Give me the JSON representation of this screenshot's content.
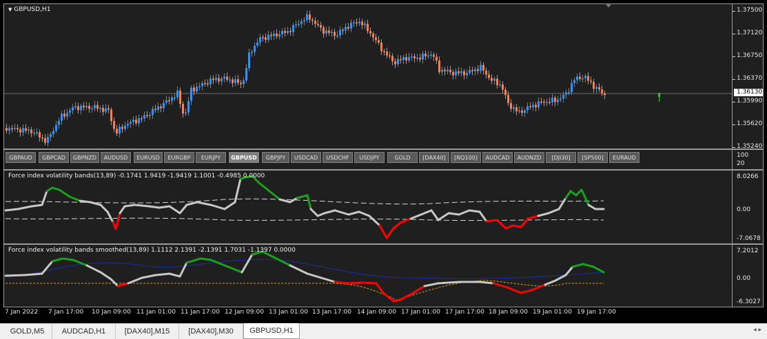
{
  "chart": {
    "symbol_title": "GBPUSD,H1"
  },
  "price_axis": {
    "labels": [
      "1.37500",
      "1.37120",
      "1.36750",
      "1.36370",
      "1.35990",
      "1.35620",
      "1.35240"
    ],
    "current_price": "1.36130"
  },
  "symbol_buttons": [
    {
      "label": "GBPAUD"
    },
    {
      "label": "GBPCAD"
    },
    {
      "label": "GBPNZD"
    },
    {
      "label": "AUDUSD"
    },
    {
      "label": "EURUSD"
    },
    {
      "label": "EURGBP"
    },
    {
      "label": "EURJPY"
    },
    {
      "label": "GBPUSD",
      "active": true
    },
    {
      "label": "GBPJPY"
    },
    {
      "label": "USDCAD"
    },
    {
      "label": "USDCHF"
    },
    {
      "label": "USDJPY"
    },
    {
      "label": "GOLD"
    },
    {
      "label": "[DAX40]"
    },
    {
      "label": "[NQ100]"
    },
    {
      "label": "AUDCAD"
    },
    {
      "label": "AUDNZD"
    },
    {
      "label": "[DJI30]"
    },
    {
      "label": "[SP500]"
    },
    {
      "label": "EURAUD"
    }
  ],
  "button_axis": {
    "labels": [
      "100",
      "20"
    ]
  },
  "indicator1": {
    "title": "Force index volatility bands(13,89) -0.1741 1.9419 -1.9419 1.1001 -0.4985 0.0000",
    "axis_labels": [
      "8.0266",
      "0.00",
      "-7.0678"
    ]
  },
  "indicator2": {
    "title": "Force index volatility bands smoothed(13,89) 1.1112 2.1391 -2.1391 1.7031 -1.1397 0.0000",
    "axis_labels": [
      "7.2012",
      "0.00",
      "-6.3027"
    ]
  },
  "time_axis": {
    "labels": [
      "7 Jan 2022",
      "7 Jan 17:00",
      "10 Jan 09:00",
      "11 Jan 01:00",
      "11 Jan 17:00",
      "12 Jan 09:00",
      "13 Jan 01:00",
      "13 Jan 17:00",
      "14 Jan 09:00",
      "17 Jan 01:00",
      "17 Jan 17:00",
      "18 Jan 09:00",
      "19 Jan 01:00",
      "19 Jan 17:00"
    ]
  },
  "tabs": [
    {
      "label": "GOLD,M5"
    },
    {
      "label": "AUDCAD,H1"
    },
    {
      "label": "[DAX40],M15"
    },
    {
      "label": "[DAX40],M30"
    },
    {
      "label": "GBPUSD,H1",
      "active": true
    }
  ],
  "colors": {
    "bull": "#3d8fe6",
    "bear": "#e8855a",
    "green": "#1aa31a",
    "red": "#ff0000",
    "gray": "#c8c8c8",
    "band": "#d8d8d8",
    "navy": "#1f2aa8",
    "orange": "#e0a000"
  }
}
